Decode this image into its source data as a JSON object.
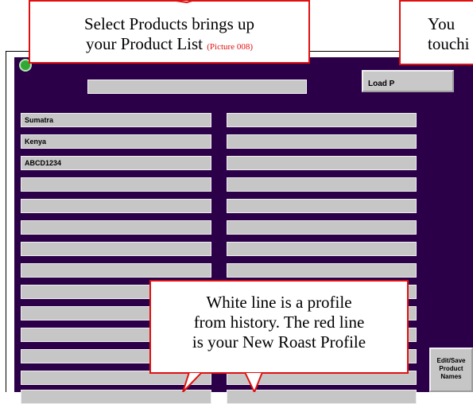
{
  "load_button_label": "Load P",
  "product_list": {
    "left_column": [
      "Sumatra",
      "Kenya",
      "ABCD1234",
      "",
      "",
      "",
      "",
      "",
      "",
      "",
      "",
      "",
      "",
      ""
    ],
    "right_column": [
      "",
      "",
      "",
      "",
      "",
      "",
      "",
      "",
      "",
      "",
      "",
      "",
      "",
      ""
    ]
  },
  "edit_button": {
    "line1": "Edit/Save",
    "line2": "Product",
    "line3": "Names"
  },
  "callouts": {
    "select_products": {
      "line1": "Select Products brings up",
      "line2": "your Product List",
      "tag": "(Picture 008)"
    },
    "top_right": {
      "line1": "You",
      "line2": "touchi"
    },
    "white_line": {
      "line1": "White line is a profile",
      "line2": "from history. The red line",
      "line3": "is your New Roast Profile"
    }
  },
  "colors": {
    "panel": "#2c0049",
    "callout_border": "#e01010",
    "field": "#c6c6c6"
  }
}
